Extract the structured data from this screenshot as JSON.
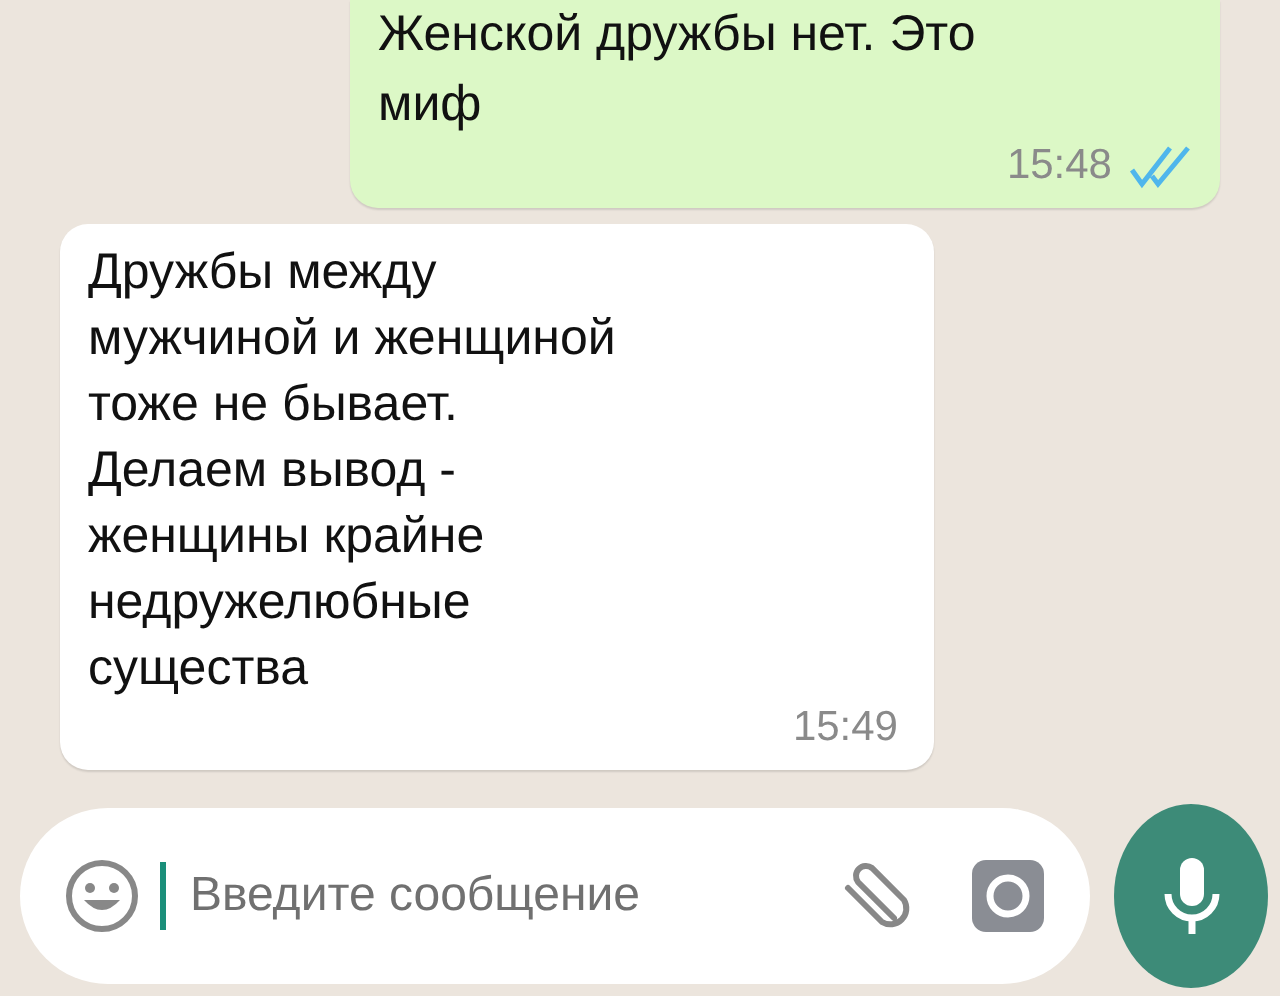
{
  "messages": [
    {
      "kind": "outgoing",
      "lines": [
        "Женской дружбы нет. Это",
        "миф"
      ],
      "time": "15:48",
      "read": true
    },
    {
      "kind": "incoming",
      "lines": [
        "Дружбы между",
        "мужчиной и женщиной",
        "тоже не бывает.",
        "Делаем вывод -",
        "женщины крайне",
        "недружелюбные",
        "существа"
      ],
      "time": "15:49"
    }
  ],
  "composer": {
    "placeholder": "Введите сообщение"
  }
}
